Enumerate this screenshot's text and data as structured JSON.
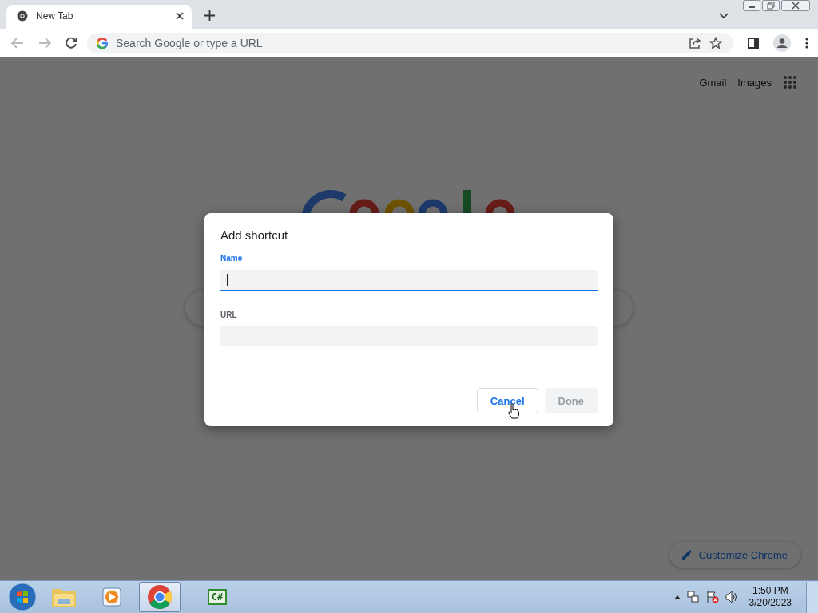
{
  "browser": {
    "tab": {
      "title": "New Tab"
    },
    "address_bar": {
      "placeholder": "Search Google or type a URL"
    }
  },
  "page": {
    "links": [
      "Gmail",
      "Images"
    ],
    "customize_button": "Customize Chrome"
  },
  "dialog": {
    "title": "Add shortcut",
    "fields": [
      {
        "label": "Name",
        "focused": true
      },
      {
        "label": "URL",
        "focused": false
      }
    ],
    "buttons": [
      {
        "label": "Cancel",
        "disabled": false
      },
      {
        "label": "Done",
        "disabled": true
      }
    ]
  },
  "taskbar": {
    "apps": [
      {
        "kind": "explorer",
        "selected": false
      },
      {
        "kind": "media",
        "selected": false
      },
      {
        "kind": "chrome",
        "selected": true
      },
      {
        "kind": "csharp",
        "selected": false,
        "label": "C#"
      }
    ],
    "clock": {
      "time": "1:50 PM",
      "date": "3/20/2023"
    }
  }
}
